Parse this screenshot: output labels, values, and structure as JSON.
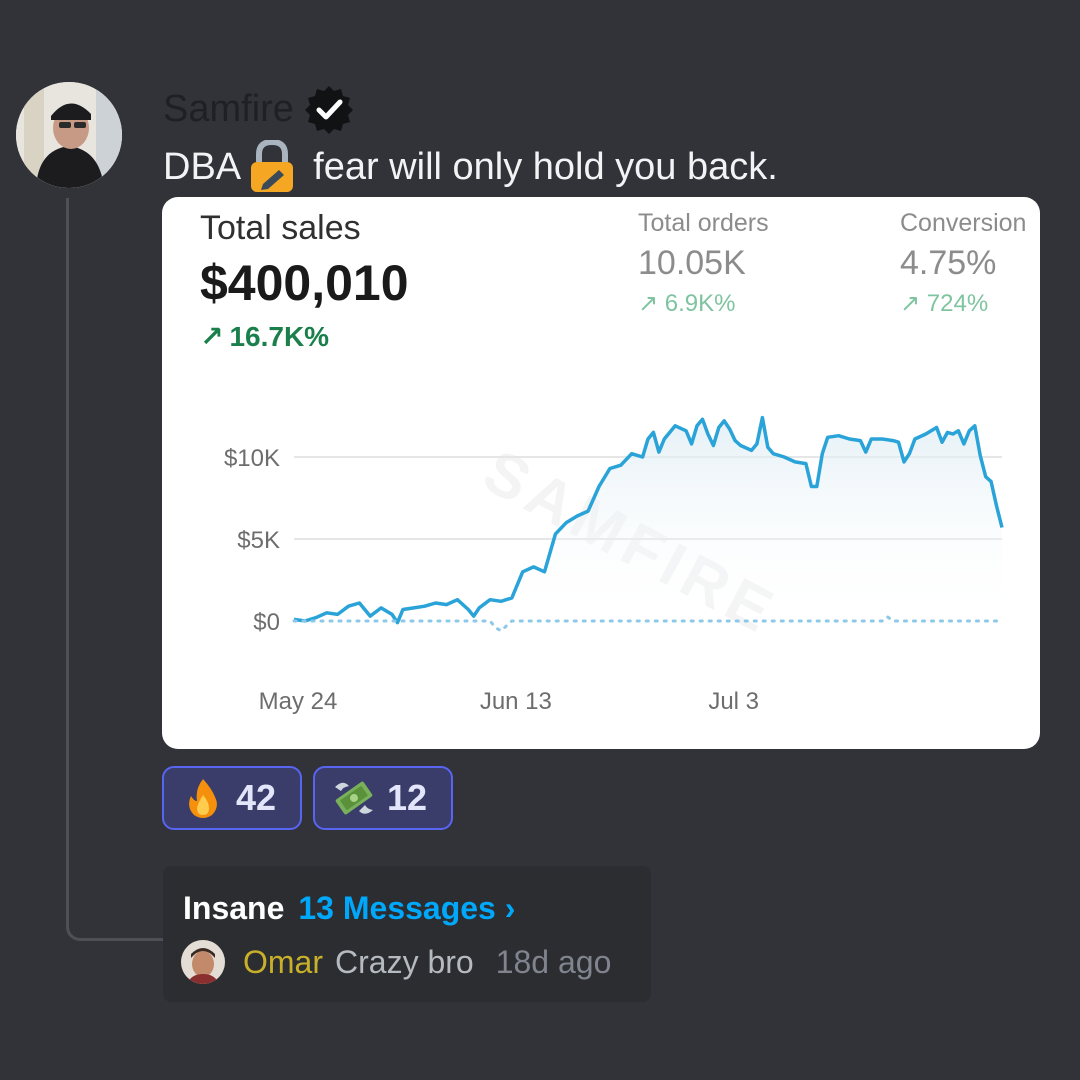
{
  "post": {
    "author": "Samfire",
    "text_before": "DBA",
    "text_after": "fear will only hold you back."
  },
  "icons": {
    "verified": "verified-badge-icon",
    "lock": "lock-with-pen-icon",
    "fire": "fire-emoji-icon",
    "money": "money-with-wings-emoji-icon"
  },
  "metrics": {
    "main": {
      "label": "Total sales",
      "value": "$400,010",
      "change": "16.7K%"
    },
    "orders": {
      "label": "Total orders",
      "value": "10.05K",
      "change": "6.9K%"
    },
    "conversion": {
      "label": "Conversion",
      "value": "4.75%",
      "change": "724%"
    }
  },
  "watermark": "SAMFIRE",
  "chart_data": {
    "type": "line",
    "title": "",
    "xlabel": "",
    "ylabel": "",
    "y_ticks": [
      "$10K",
      "$5K",
      "$0"
    ],
    "x_ticks": [
      "May 24",
      "Jun 13",
      "Jul 3"
    ],
    "ylim": [
      0,
      12500
    ],
    "grid": true,
    "series": [
      {
        "style": "solid",
        "color": "#29a3d8",
        "points": [
          [
            0,
            100
          ],
          [
            2,
            0
          ],
          [
            4,
            200
          ],
          [
            6,
            500
          ],
          [
            8,
            400
          ],
          [
            10,
            900
          ],
          [
            12,
            1100
          ],
          [
            14,
            300
          ],
          [
            16,
            800
          ],
          [
            18,
            400
          ],
          [
            19,
            -100
          ],
          [
            20,
            700
          ],
          [
            22,
            800
          ],
          [
            24,
            900
          ],
          [
            26,
            1100
          ],
          [
            28,
            1000
          ],
          [
            30,
            1300
          ],
          [
            32,
            700
          ],
          [
            33,
            300
          ],
          [
            34,
            800
          ],
          [
            36,
            1300
          ],
          [
            38,
            1200
          ],
          [
            40,
            1400
          ],
          [
            42,
            3000
          ],
          [
            44,
            3300
          ],
          [
            46,
            3000
          ],
          [
            48,
            5300
          ],
          [
            50,
            6000
          ],
          [
            52,
            6400
          ],
          [
            54,
            6700
          ],
          [
            56,
            8200
          ],
          [
            58,
            9300
          ],
          [
            60,
            9500
          ],
          [
            62,
            10200
          ],
          [
            64,
            10000
          ],
          [
            65,
            11100
          ],
          [
            66,
            11500
          ],
          [
            67,
            10300
          ],
          [
            68,
            11100
          ],
          [
            70,
            11900
          ],
          [
            72,
            11600
          ],
          [
            73,
            10800
          ],
          [
            74,
            11900
          ],
          [
            75,
            12300
          ],
          [
            76,
            11400
          ],
          [
            77,
            10700
          ],
          [
            78,
            11800
          ],
          [
            79,
            12200
          ],
          [
            80,
            11700
          ],
          [
            81,
            11000
          ],
          [
            82,
            10700
          ],
          [
            84,
            10400
          ],
          [
            85,
            10800
          ],
          [
            86,
            12400
          ],
          [
            87,
            10600
          ],
          [
            88,
            10200
          ],
          [
            90,
            10000
          ],
          [
            92,
            9700
          ],
          [
            94,
            9600
          ],
          [
            95,
            8200
          ],
          [
            96,
            8200
          ],
          [
            97,
            10200
          ],
          [
            98,
            11200
          ],
          [
            100,
            11300
          ],
          [
            102,
            11100
          ],
          [
            104,
            11000
          ],
          [
            105,
            10300
          ],
          [
            106,
            11100
          ],
          [
            108,
            11100
          ],
          [
            110,
            11000
          ],
          [
            111,
            10900
          ],
          [
            112,
            9700
          ],
          [
            113,
            10200
          ],
          [
            114,
            11100
          ],
          [
            116,
            11400
          ],
          [
            118,
            11800
          ],
          [
            119,
            10900
          ],
          [
            120,
            11500
          ],
          [
            121,
            11400
          ],
          [
            122,
            11600
          ],
          [
            123,
            10800
          ],
          [
            124,
            11600
          ],
          [
            125,
            11900
          ],
          [
            126,
            10100
          ],
          [
            127,
            8800
          ],
          [
            128,
            8500
          ],
          [
            129,
            7000
          ],
          [
            130,
            5700
          ]
        ]
      },
      {
        "style": "dotted",
        "color": "#8cc9e8",
        "points": [
          [
            0,
            0
          ],
          [
            10,
            0
          ],
          [
            20,
            0
          ],
          [
            30,
            0
          ],
          [
            36,
            0
          ],
          [
            37,
            -400
          ],
          [
            38,
            -600
          ],
          [
            39,
            -300
          ],
          [
            40,
            0
          ],
          [
            60,
            0
          ],
          [
            80,
            0
          ],
          [
            100,
            0
          ],
          [
            108,
            0
          ],
          [
            109,
            250
          ],
          [
            110,
            0
          ],
          [
            120,
            0
          ],
          [
            130,
            0
          ]
        ]
      }
    ]
  },
  "reactions": [
    {
      "emoji": "fire",
      "count": "42"
    },
    {
      "emoji": "money-with-wings",
      "count": "12"
    }
  ],
  "thread": {
    "name": "Insane",
    "count_label": "13 Messages ›",
    "last_author": "Omar",
    "last_text": "Crazy bro",
    "last_time": "18d ago"
  }
}
